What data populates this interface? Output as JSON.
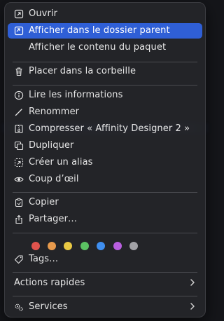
{
  "menu": {
    "items": {
      "open": "Ouvrir",
      "show_in_parent": "Afficher dans le dossier parent",
      "show_package_contents": "Afficher le contenu du paquet",
      "move_to_trash": "Placer dans la corbeille",
      "get_info": "Lire les informations",
      "rename": "Renommer",
      "compress": "Compresser « Affinity Designer 2 »",
      "duplicate": "Dupliquer",
      "make_alias": "Créer un alias",
      "quick_look": "Coup d’œil",
      "copy": "Copier",
      "share": "Partager…",
      "tags": "Tags…",
      "quick_actions": "Actions rapides",
      "services": "Services"
    },
    "tag_colors": {
      "red": "#e0534d",
      "orange": "#e79a4c",
      "yellow": "#e9c944",
      "green": "#5cc163",
      "blue": "#3f8ff0",
      "purple": "#b95fe0",
      "gray": "#a1a1a6"
    },
    "accent_color": "#2f5fd6"
  }
}
